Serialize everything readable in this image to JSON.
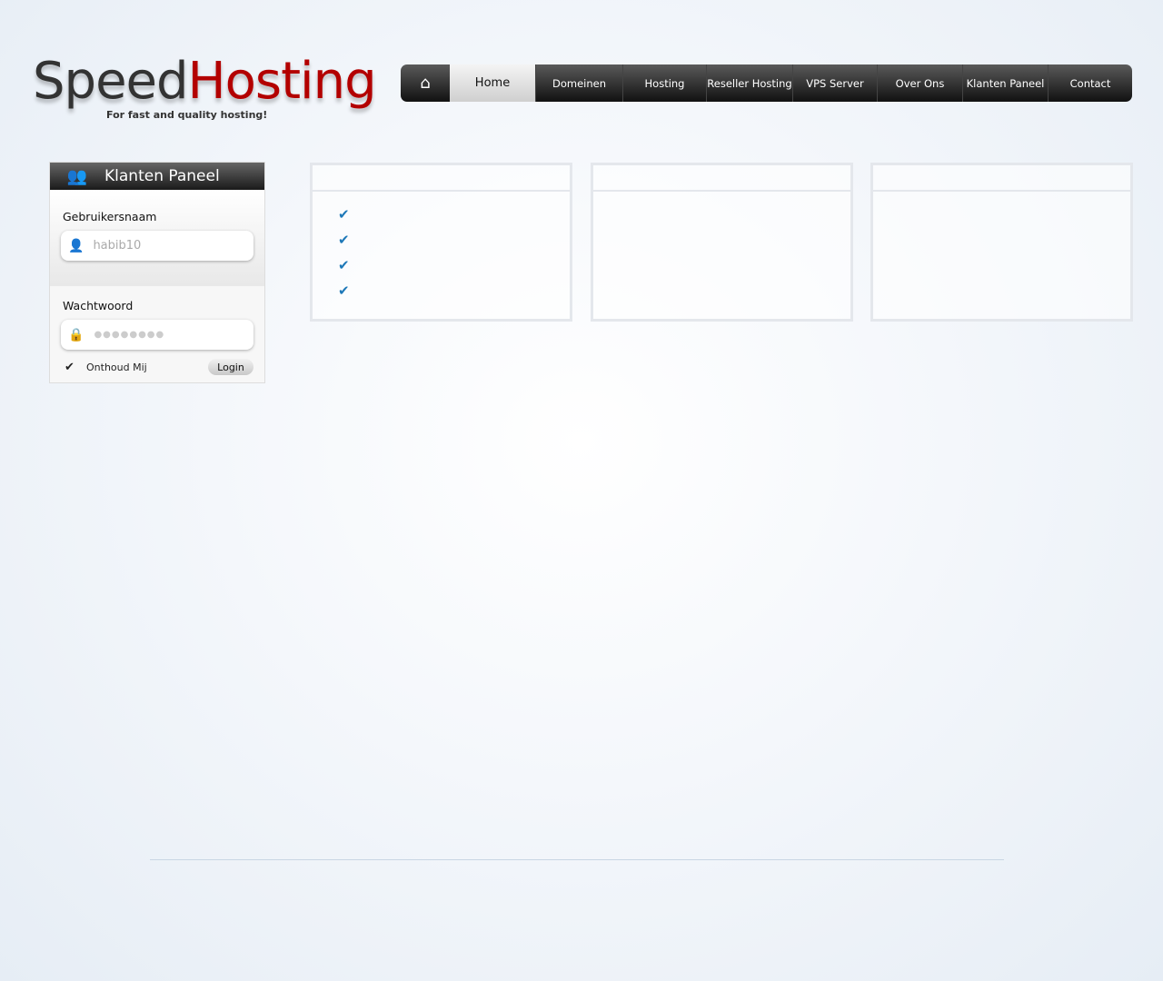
{
  "logo": {
    "part1": "Speed",
    "part2": "Hosting",
    "tagline": "For fast and quality hosting!"
  },
  "nav": {
    "home_icon": "home-icon",
    "items": [
      "Home",
      "Domeinen",
      "Hosting",
      "Reseller Hosting",
      "VPS Server",
      "Over Ons",
      "Klanten Paneel",
      "Contact"
    ],
    "active": "Home"
  },
  "login": {
    "title": "Klanten Paneel",
    "username_label": "Gebruikersnaam",
    "username_value": "habib10",
    "password_label": "Wachtwoord",
    "password_value": "●●●●●●●●",
    "remember_label": "Onthoud Mij",
    "remember_checked": true,
    "login_button": "Login"
  },
  "colors": {
    "brand_red": "#b30000",
    "check_blue": "#1d78b8"
  }
}
